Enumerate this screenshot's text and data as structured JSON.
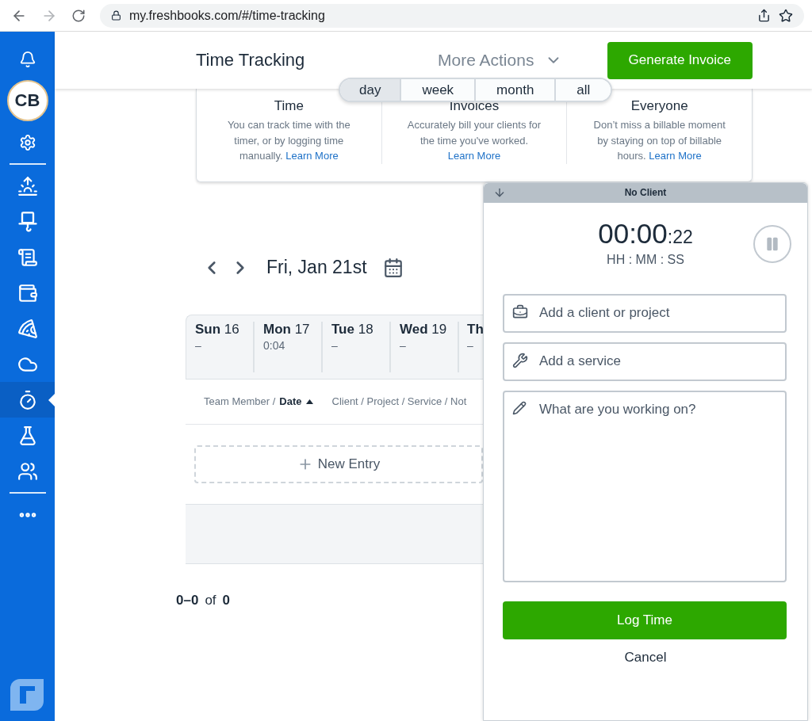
{
  "browser": {
    "url": "my.freshbooks.com/#/time-tracking"
  },
  "sidebar": {
    "avatar": "CB",
    "top_items": [
      {
        "selected": false
      }
    ],
    "items": [
      {
        "selected": false
      },
      {
        "selected": false
      },
      {
        "selected": false
      },
      {
        "selected": false
      },
      {
        "selected": false
      },
      {
        "selected": false
      },
      {
        "selected": true
      },
      {
        "selected": false
      },
      {
        "selected": false
      }
    ]
  },
  "header": {
    "title": "Time Tracking",
    "more_actions": "More Actions",
    "primary_button": "Generate Invoice"
  },
  "range_tabs": [
    {
      "label": "day",
      "selected": true
    },
    {
      "label": "week",
      "selected": false
    },
    {
      "label": "month",
      "selected": false
    },
    {
      "label": "all",
      "selected": false
    }
  ],
  "info_card": {
    "columns": [
      {
        "heading": "Time",
        "text": "You can track time with the timer, or by logging time manually.",
        "link": "Learn More"
      },
      {
        "heading": "Invoices",
        "text": "Accurately bill your clients for the time you've worked.",
        "link": "Learn More"
      },
      {
        "heading": "Everyone",
        "text": "Don’t miss a billable moment by staying on top of billable hours.",
        "link": "Learn More"
      }
    ]
  },
  "date_nav": {
    "date": "Fri, Jan 21st"
  },
  "week": [
    {
      "day": "Sun",
      "num": "16",
      "total": "–"
    },
    {
      "day": "Mon",
      "num": "17",
      "total": "0:04"
    },
    {
      "day": "Tue",
      "num": "18",
      "total": "–"
    },
    {
      "day": "Wed",
      "num": "19",
      "total": "–"
    },
    {
      "day": "Th",
      "total": "–"
    }
  ],
  "table": {
    "sort_columns": [
      {
        "label": "Team Member /",
        "sorted": false
      },
      {
        "label": "Date",
        "sorted": true
      }
    ],
    "other_column": "Client / Project / Service / Not",
    "new_entry": "New Entry"
  },
  "pagination": {
    "range": "0–0",
    "of": "of",
    "total": "0"
  },
  "timer": {
    "client": "No Client",
    "time": "00:00",
    "seconds": ":22",
    "format": "HH : MM : SS",
    "client_placeholder": "Add a client or project",
    "service_placeholder": "Add a service",
    "notes_placeholder": "What are you working on?",
    "log_button": "Log Time",
    "cancel": "Cancel"
  }
}
